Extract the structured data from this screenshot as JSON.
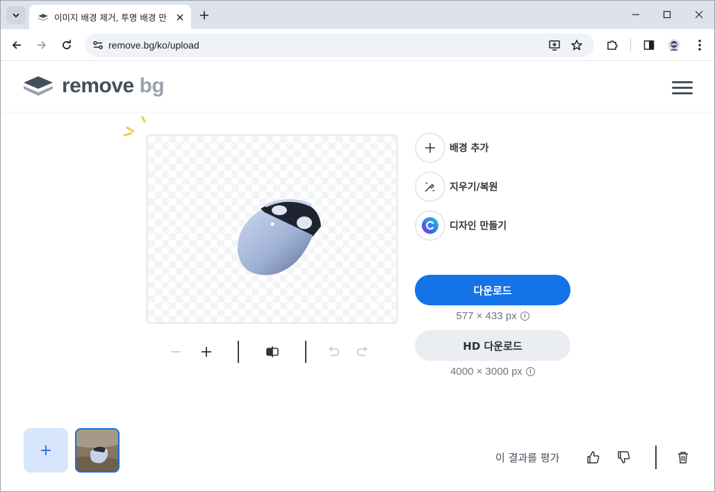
{
  "browser": {
    "tab_title": "이미지 배경 제거, 투명 배경 만",
    "url": "remove.bg/ko/upload"
  },
  "site": {
    "logo_text_main": "remove",
    "logo_text_accent": "bg"
  },
  "tools": [
    {
      "label": "배경 추가",
      "icon": "plus-icon"
    },
    {
      "label": "지우기/복원",
      "icon": "magic-brush-icon"
    },
    {
      "label": "디자인 만들기",
      "icon": "canva-icon"
    }
  ],
  "download": {
    "label": "다운로드",
    "resolution": "577 × 433 px"
  },
  "hd_download": {
    "label": "HD 다운로드",
    "resolution": "4000 × 3000 px"
  },
  "rating": {
    "label": "이 결과를 평가"
  },
  "info_glyph": "i",
  "colors": {
    "accent": "#1473e6",
    "logo_dark": "#454f5b",
    "logo_light": "#9aa3ad",
    "add_tile": "#d7e5fd"
  }
}
